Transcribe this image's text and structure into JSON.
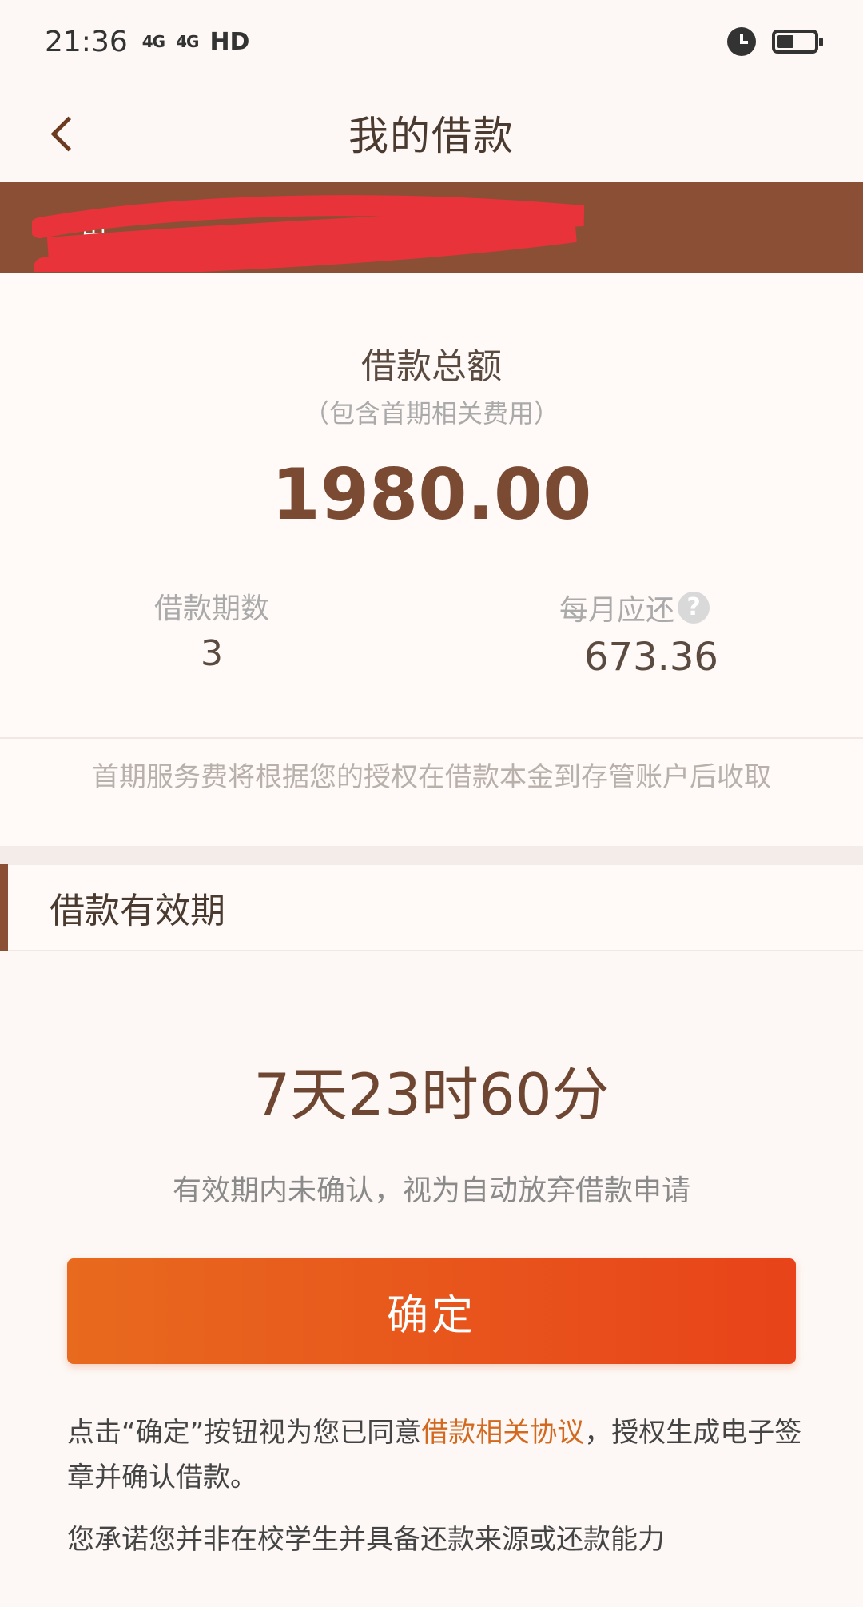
{
  "status_bar": {
    "time": "21:36",
    "signal1": "4G",
    "signal2": "4G",
    "hd": "HD"
  },
  "nav": {
    "title": "我的借款"
  },
  "account": {
    "visible_fragment": "甪"
  },
  "summary": {
    "total_label": "借款总额",
    "total_note": "（包含首期相关费用）",
    "total_amount": "1980.00",
    "term_label": "借款期数",
    "term_value": "3",
    "monthly_label": "每月应还",
    "monthly_value": "673.36",
    "help_glyph": "?"
  },
  "fee_note": "首期服务费将根据您的授权在借款本金到存管账户后收取",
  "validity": {
    "title": "借款有效期",
    "countdown": "7天23时60分",
    "note": "有效期内未确认，视为自动放弃借款申请"
  },
  "confirm": {
    "label": "确定"
  },
  "agreement": {
    "prefix": "点击“确定”按钮视为您已同意",
    "link": "借款相关协议",
    "suffix": "，授权生成电子签章并确认借款。",
    "promise": "您承诺您并非在校学生并具备还款来源或还款能力"
  },
  "colors": {
    "brand_brown": "#8b4f35",
    "button_start": "#e86a1e",
    "button_end": "#e8431a",
    "link": "#d2691e"
  }
}
